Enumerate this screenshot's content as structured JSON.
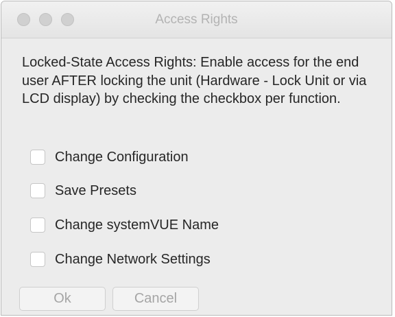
{
  "window": {
    "title": "Access Rights"
  },
  "description": "Locked-State Access Rights: Enable access for the end user AFTER locking the unit (Hardware - Lock Unit or via LCD display) by checking the checkbox per function.",
  "options": [
    {
      "label": "Change Configuration",
      "checked": false
    },
    {
      "label": "Save Presets",
      "checked": false
    },
    {
      "label": "Change systemVUE Name",
      "checked": false
    },
    {
      "label": "Change Network Settings",
      "checked": false
    }
  ],
  "buttons": {
    "ok_label": "Ok",
    "cancel_label": "Cancel"
  },
  "colors": {
    "window_bg": "#ececec",
    "title_text": "#b3b3b3",
    "body_text": "#262626",
    "disabled_button_text": "#a5a5a5"
  }
}
